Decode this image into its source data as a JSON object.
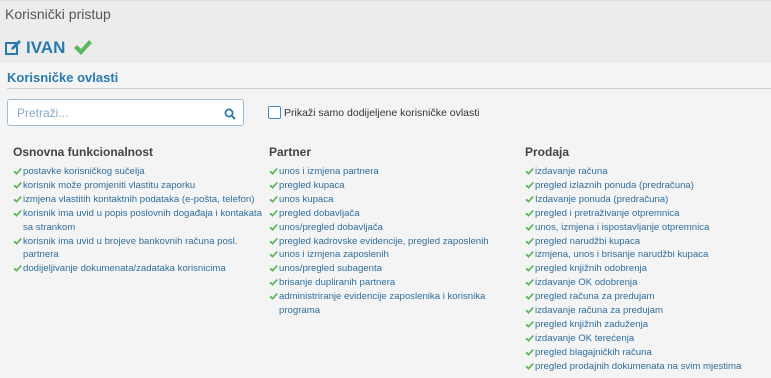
{
  "header": {
    "title": "Korisnički pristup",
    "user_name": "IVAN"
  },
  "section": {
    "title": "Korisničke ovlasti"
  },
  "search": {
    "placeholder": "Pretraži...",
    "value": ""
  },
  "filter": {
    "label": "Prikaži samo dodijeljene korisničke ovlasti",
    "checked": false
  },
  "columns": [
    {
      "title": "Osnovna funkcionalnost",
      "items": [
        "postavke korisničkog sučelja",
        "korisnik može promjeniti vlastitu zaporku",
        "izmjena vlastitih kontaktnih podataka (e-pošta, telefon)",
        "korisnik ima uvid u popis poslovnih događaja i kontakata sa strankom",
        "korisnik ima uvid u brojeve bankovnih računa posl. partnera",
        "dodijeljivanje dokumenata/zadataka korisnicima"
      ]
    },
    {
      "title": "Partner",
      "items": [
        "unos i izmjena partnera",
        "pregled kupaca",
        "unos kupaca",
        "pregled dobavljača",
        "unos/pregled dobavljača",
        "pregled kadrovske evidencije, pregled zaposlenih",
        "unos i izmjena zaposlenih",
        "unos/pregled subagenta",
        "brisanje dupliranih partnera",
        "administriranje evidencije zaposlenika i korisnika programa"
      ]
    },
    {
      "title": "Prodaja",
      "items": [
        "izdavanje računa",
        "pregled izlaznih ponuda (predračuna)",
        "Izdavanje ponuda (predračuna)",
        "pregled i pretraživanje otpremnica",
        "unos, izmjena i ispostavljanje otpremnica",
        "pregled narudžbi kupaca",
        "izmjena, unos i brisanje narudžbi kupaca",
        "pregled knjižnih odobrenja",
        "izdavanje OK odobrenja",
        "pregled računa za predujam",
        "izdavanje računa za predujam",
        "pregled knjižnih zaduženja",
        "izdavanje OK terećenja",
        "pregled blagajničkih računa",
        "pregled prodajnih dokumenata na svim mjestima"
      ]
    }
  ],
  "colors": {
    "accent": "#2a7ab0",
    "check": "#5cb85c",
    "link": "#2f6e9e"
  },
  "icons": {
    "edit": "edit-icon",
    "status": "check-icon",
    "search": "search-icon",
    "item": "check-icon"
  }
}
